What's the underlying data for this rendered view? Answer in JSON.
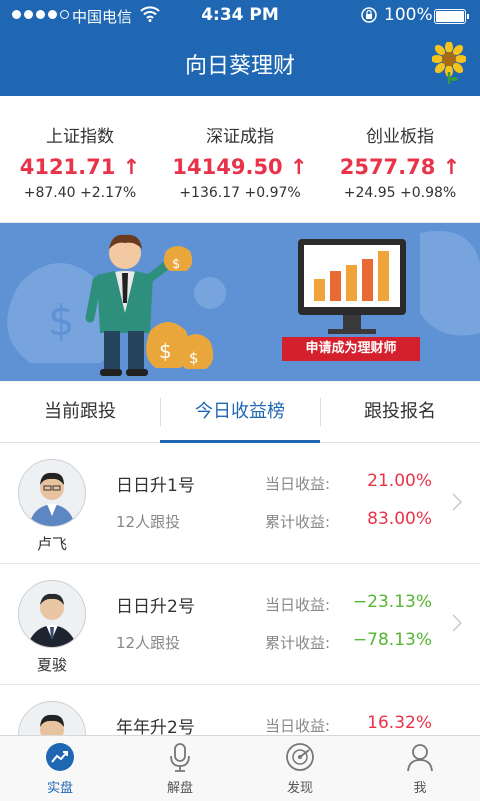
{
  "status_bar": {
    "carrier": "中国电信",
    "time": "4:34 PM",
    "battery": "100%"
  },
  "header": {
    "title": "向日葵理财"
  },
  "indices": [
    {
      "name": "上证指数",
      "value": "4121.71 ↑",
      "change": "+87.40  +2.17%"
    },
    {
      "name": "深证成指",
      "value": "14149.50 ↑",
      "change": "+136.17 +0.97%"
    },
    {
      "name": "创业板指",
      "value": "2577.78 ↑",
      "change": "+24.95  +0.98%"
    }
  ],
  "banner": {
    "cta": "申请成为理财师"
  },
  "tabs": [
    {
      "label": "当前跟投"
    },
    {
      "label": "今日收益榜"
    },
    {
      "label": "跟投报名"
    }
  ],
  "labels": {
    "today": "当日收益:",
    "total": "累计收益:"
  },
  "rows": [
    {
      "advisor": "卢飞",
      "product": "日日升1号",
      "followers": "12人跟投",
      "today": "21.00%",
      "total": "83.00%",
      "today_color": "red",
      "total_color": "red"
    },
    {
      "advisor": "夏骏",
      "product": "日日升2号",
      "followers": "12人跟投",
      "today": "−23.13%",
      "total": "−78.13%",
      "today_color": "green",
      "total_color": "green"
    },
    {
      "advisor": "",
      "product": "年年升2号",
      "followers": "",
      "today": "16.32%",
      "total": "",
      "today_color": "red",
      "total_color": "red"
    }
  ],
  "tabbar": [
    {
      "label": "实盘"
    },
    {
      "label": "解盘"
    },
    {
      "label": "发现"
    },
    {
      "label": "我"
    }
  ],
  "colors": {
    "brand": "#1f67b3",
    "up": "#e8334a",
    "down": "#55b534"
  }
}
